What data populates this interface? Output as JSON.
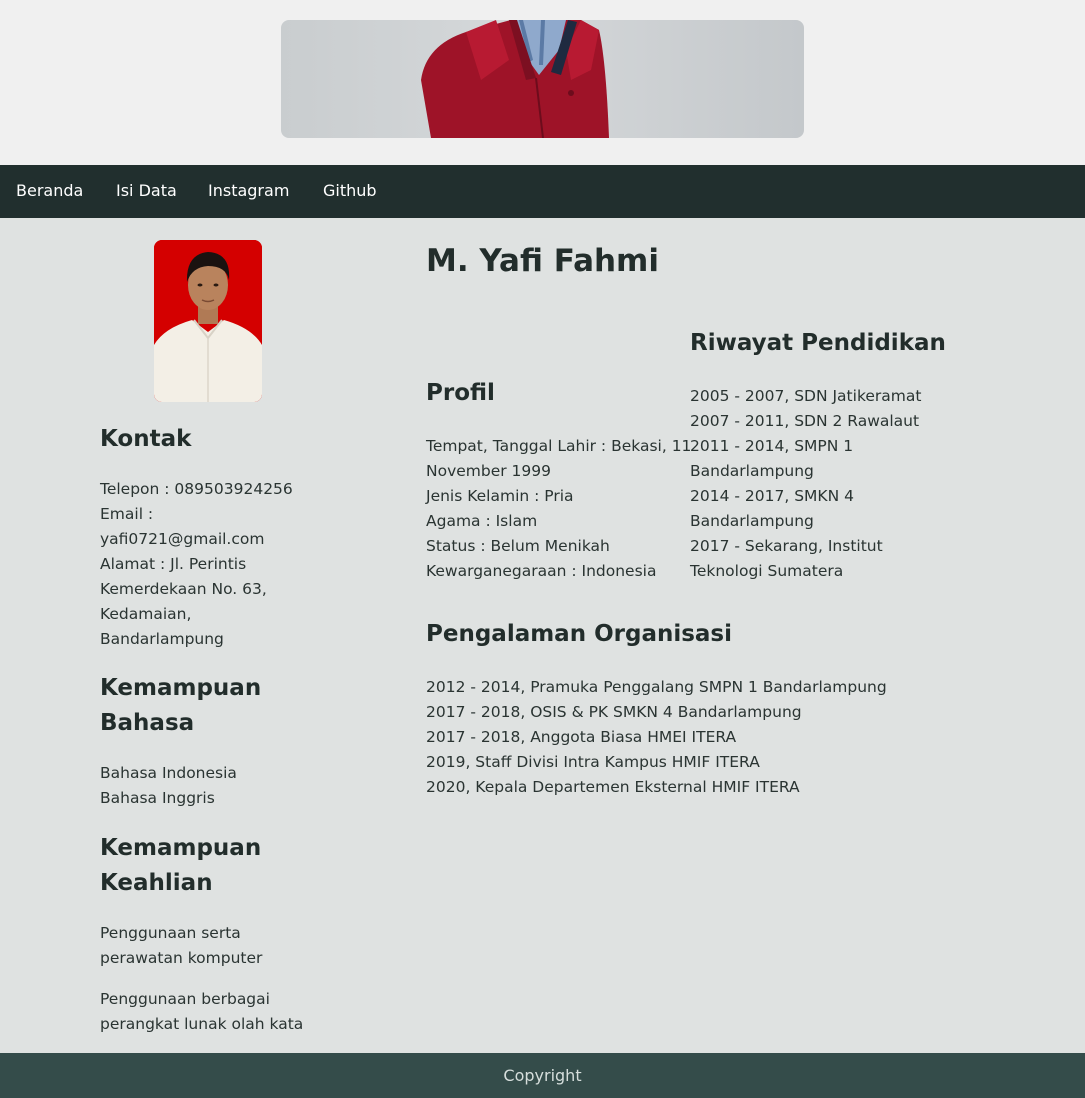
{
  "nav": {
    "items": [
      {
        "label": "Beranda"
      },
      {
        "label": "Isi Data"
      },
      {
        "label": "Instagram"
      },
      {
        "label": "Github"
      }
    ]
  },
  "profile": {
    "name": "M. Yafi Fahmi"
  },
  "kontak": {
    "heading": "Kontak",
    "lines": [
      "Telepon : 089503924256",
      "Email :",
      "yafi0721@gmail.com",
      "Alamat : Jl. Perintis",
      "Kemerdekaan No. 63,",
      "Kedamaian,",
      "Bandarlampung"
    ]
  },
  "bahasa": {
    "heading_line1": "Kemampuan",
    "heading_line2": "Bahasa",
    "items": [
      "Bahasa Indonesia",
      "Bahasa Inggris"
    ]
  },
  "keahlian": {
    "heading_line1": "Kemampuan",
    "heading_line2": "Keahlian",
    "items": [
      [
        "Penggunaan serta",
        "perawatan komputer"
      ],
      [
        "Penggunaan berbagai",
        "perangkat lunak olah kata"
      ]
    ]
  },
  "profil": {
    "heading": "Profil",
    "lines": [
      "Tempat, Tanggal Lahir : Bekasi, 11",
      "November 1999",
      "Jenis Kelamin : Pria",
      "Agama : Islam",
      "Status : Belum Menikah",
      "Kewarganegaraan : Indonesia"
    ]
  },
  "pendidikan": {
    "heading": "Riwayat Pendidikan",
    "lines": [
      "2005 - 2007, SDN Jatikeramat",
      "2007 - 2011, SDN 2 Rawalaut",
      "2011 - 2014, SMPN 1",
      "Bandarlampung",
      "2014 - 2017, SMKN 4",
      "Bandarlampung",
      "2017 - Sekarang, Institut",
      "Teknologi Sumatera"
    ]
  },
  "organisasi": {
    "heading": "Pengalaman Organisasi",
    "lines": [
      "2012 - 2014, Pramuka Penggalang SMPN 1 Bandarlampung",
      "2017 - 2018, OSIS & PK SMKN 4 Bandarlampung",
      "2017 - 2018, Anggota Biasa HMEI ITERA",
      "2019, Staff Divisi Intra Kampus HMIF ITERA",
      "2020, Kepala Departemen Eksternal HMIF ITERA"
    ]
  },
  "footer": {
    "text": "Copyright"
  },
  "colors": {
    "navbar": "#212f2e",
    "footer": "#344c4a",
    "page_bg": "#dfe2e1",
    "header_bg": "#f0f0f0",
    "photo_bg": "#d40000"
  }
}
